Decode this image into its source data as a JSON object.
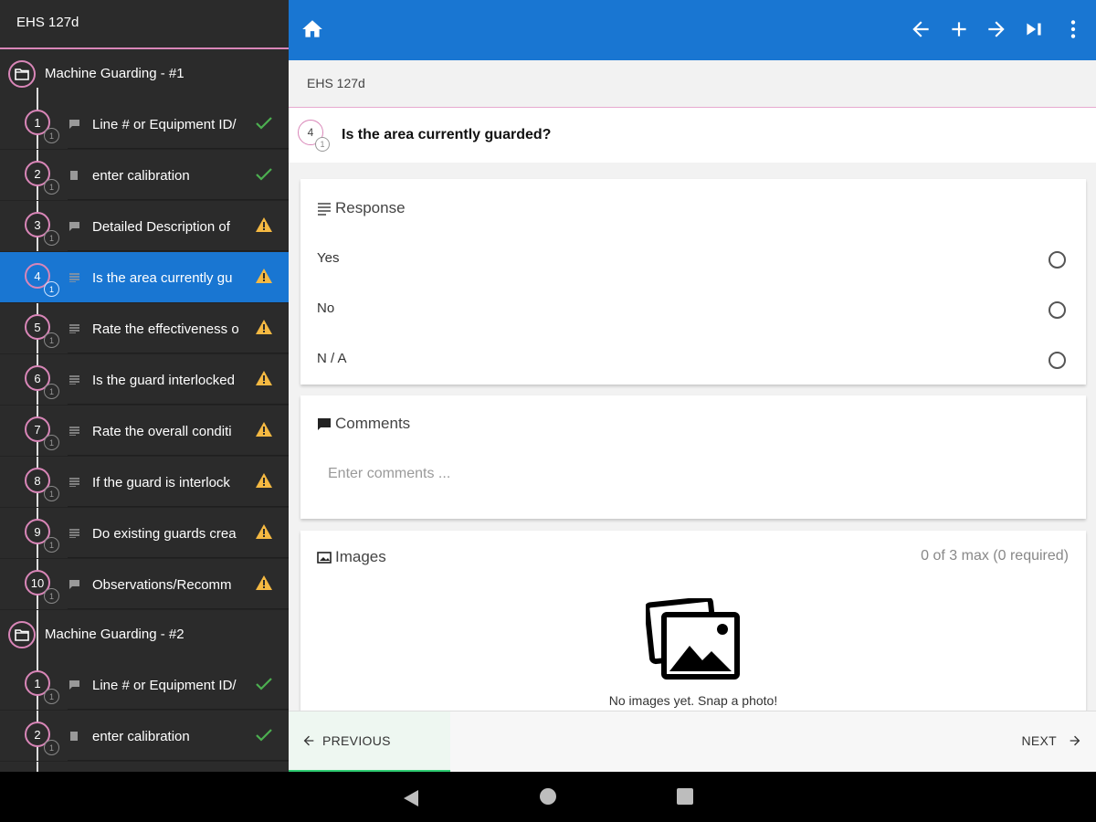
{
  "sidebar": {
    "title": "EHS 127d",
    "sections": [
      {
        "label": "Machine Guarding - #1",
        "items": [
          {
            "num": "1",
            "sub": "1",
            "label": "Line # or Equipment ID/",
            "status": "check",
            "type": "comment"
          },
          {
            "num": "2",
            "sub": "1",
            "label": "enter calibration",
            "status": "check",
            "type": "numeric"
          },
          {
            "num": "3",
            "sub": "1",
            "label": "Detailed Description of",
            "status": "warn",
            "type": "comment"
          },
          {
            "num": "4",
            "sub": "1",
            "label": "Is the area currently gu",
            "status": "warn",
            "type": "list",
            "active": true
          },
          {
            "num": "5",
            "sub": "1",
            "label": "Rate the effectiveness o",
            "status": "warn",
            "type": "list"
          },
          {
            "num": "6",
            "sub": "1",
            "label": "Is the guard interlocked",
            "status": "warn",
            "type": "list"
          },
          {
            "num": "7",
            "sub": "1",
            "label": "Rate the overall conditi",
            "status": "warn",
            "type": "list"
          },
          {
            "num": "8",
            "sub": "1",
            "label": "If the guard is interlock",
            "status": "warn",
            "type": "list"
          },
          {
            "num": "9",
            "sub": "1",
            "label": "Do existing guards crea",
            "status": "warn",
            "type": "list"
          },
          {
            "num": "10",
            "sub": "1",
            "label": "Observations/Recomm",
            "status": "warn",
            "type": "comment"
          }
        ]
      },
      {
        "label": "Machine Guarding - #2",
        "items": [
          {
            "num": "1",
            "sub": "1",
            "label": "Line # or Equipment ID/",
            "status": "check",
            "type": "comment"
          },
          {
            "num": "2",
            "sub": "1",
            "label": "enter calibration",
            "status": "check",
            "type": "numeric"
          }
        ]
      }
    ]
  },
  "main": {
    "breadcrumb": "EHS 127d",
    "question": {
      "num": "4",
      "sub": "1",
      "text": "Is the area currently guarded?"
    },
    "response": {
      "title": "Response",
      "options": [
        "Yes",
        "No",
        "N / A"
      ]
    },
    "comments": {
      "title": "Comments",
      "placeholder": "Enter comments ..."
    },
    "images": {
      "title": "Images",
      "count": "0 of 3 max (0 required)",
      "empty": "No images yet. Snap a photo!"
    },
    "footer": {
      "previous": "PREVIOUS",
      "next": "NEXT"
    }
  },
  "icons": {
    "home": "home-icon",
    "back": "arrow-left-icon",
    "add": "plus-icon",
    "forward": "arrow-right-icon",
    "last": "skip-to-end-icon",
    "more": "more-vert-icon"
  },
  "colors": {
    "accent": "#1976d2",
    "sidebar_bg": "#2b2b2b",
    "pink": "#d986b8",
    "check": "#4caf50",
    "warn": "#f5b942",
    "next_bar": "#2ecc71"
  }
}
